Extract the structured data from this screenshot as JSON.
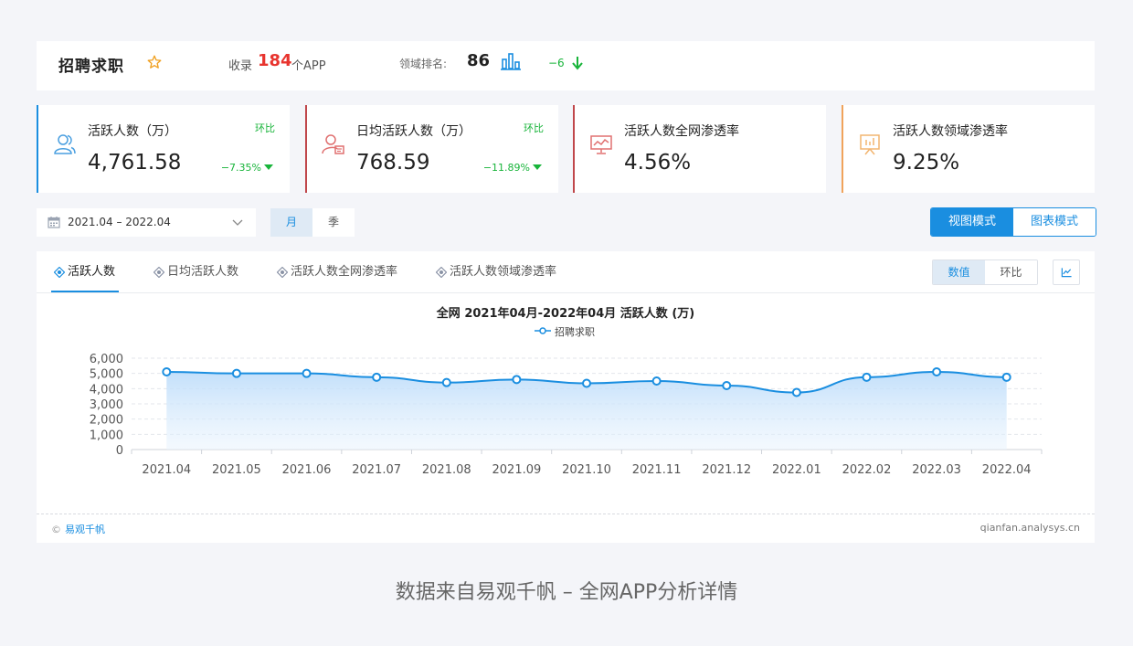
{
  "header": {
    "title": "招聘求职",
    "collect_label": "收录",
    "collect_count": "184",
    "collect_unit": "个APP",
    "rank_label": "领域排名:",
    "rank_value": "86",
    "rank_change": "−6"
  },
  "metrics": [
    {
      "label": "活跃人数（万）",
      "value": "4,761.58",
      "compare_label": "环比",
      "change": "−7.35%",
      "icon": "users-icon",
      "accent": "#1a8ee0"
    },
    {
      "label": "日均活跃人数（万）",
      "value": "768.59",
      "compare_label": "环比",
      "change": "−11.89%",
      "icon": "user-calendar-icon",
      "accent": "#c0474b"
    },
    {
      "label": "活跃人数全网渗透率",
      "value": "4.56%",
      "icon": "presentation-chart-icon",
      "accent": "#c0474b"
    },
    {
      "label": "活跃人数领域渗透率",
      "value": "9.25%",
      "icon": "presentation-board-icon",
      "accent": "#f0a35b"
    }
  ],
  "controls": {
    "date_range": "2021.04 – 2022.04",
    "period_tabs": [
      "月",
      "季"
    ],
    "mode_tabs": [
      "视图模式",
      "图表模式"
    ]
  },
  "panel": {
    "tabs": [
      "活跃人数",
      "日均活跃人数",
      "活跃人数全网渗透率",
      "活跃人数领域渗透率"
    ],
    "value_tabs": [
      "数值",
      "环比"
    ],
    "copyright": "易观千帆",
    "site": "qianfan.analysys.cn"
  },
  "chart_data": {
    "type": "area",
    "title": "全网 2021年04月-2022年04月 活跃人数 (万)",
    "categories": [
      "2021.04",
      "2021.05",
      "2021.06",
      "2021.07",
      "2021.08",
      "2021.09",
      "2021.10",
      "2021.11",
      "2021.12",
      "2022.01",
      "2022.02",
      "2022.03",
      "2022.04"
    ],
    "series": [
      {
        "name": "招聘求职",
        "values": [
          5100,
          5000,
          5000,
          4750,
          4400,
          4600,
          4350,
          4500,
          4200,
          3750,
          4750,
          5100,
          4750
        ]
      }
    ],
    "yticks": [
      "0",
      "1,000",
      "2,000",
      "3,000",
      "4,000",
      "5,000",
      "6,000"
    ],
    "ylim": [
      0,
      6000
    ],
    "grid": true,
    "legend": "top-center",
    "color": "#1a8ee0"
  },
  "caption": "数据来自易观千帆 – 全网APP分析详情"
}
